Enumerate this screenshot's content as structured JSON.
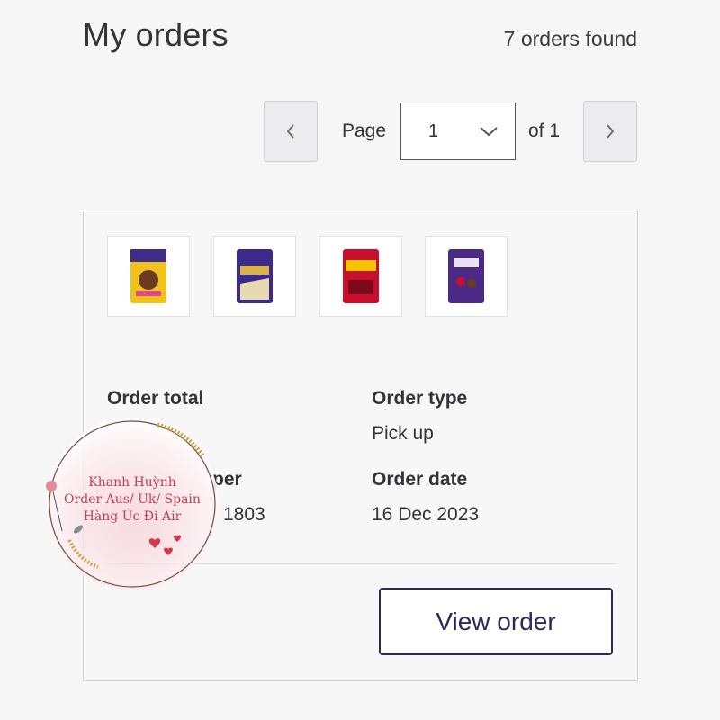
{
  "header": {
    "title": "My orders",
    "orders_found": "7 orders found"
  },
  "pagination": {
    "page_label": "Page",
    "current_page": "1",
    "of_label": "of 1",
    "prev_icon": "chevron-left-icon",
    "next_icon": "chevron-right-icon",
    "dropdown_icon": "chevron-down-icon"
  },
  "order": {
    "products": [
      {
        "name": "Dairy Milk Caramello Koala",
        "color": "#f0c21e"
      },
      {
        "name": "Caramilk",
        "color": "#3b2a8c"
      },
      {
        "name": "Cherry Ripe",
        "color": "#c8102e"
      },
      {
        "name": "Dairy Milk",
        "color": "#4b2a86"
      }
    ],
    "total_label": "Order total",
    "number_label_partial": "per",
    "number_value_partial": "1803",
    "type_label": "Order type",
    "type_value": "Pick up",
    "date_label": "Order date",
    "date_value": "16 Dec 2023",
    "view_button": "View order"
  },
  "watermark": {
    "line1": "Khanh Huỳnh",
    "line2": "Order Aus/ Uk/ Spain",
    "line3": "Hàng Úc Đi Air"
  },
  "colors": {
    "accent": "#2b2862",
    "watermark_text": "#c14054",
    "card_border": "#d0d0d6"
  }
}
